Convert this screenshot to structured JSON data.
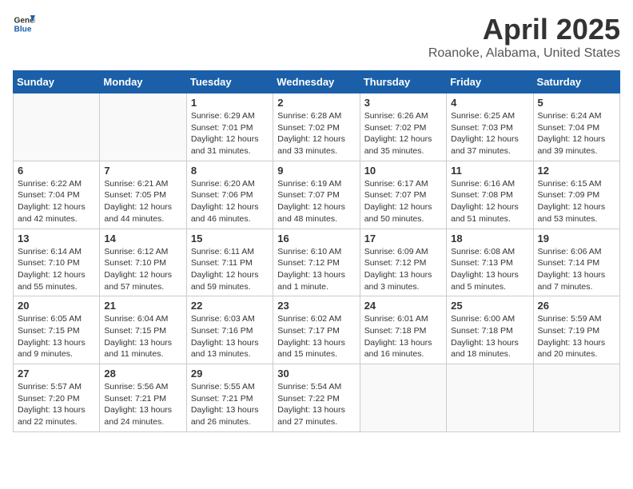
{
  "header": {
    "logo_general": "General",
    "logo_blue": "Blue",
    "title": "April 2025",
    "subtitle": "Roanoke, Alabama, United States"
  },
  "weekdays": [
    "Sunday",
    "Monday",
    "Tuesday",
    "Wednesday",
    "Thursday",
    "Friday",
    "Saturday"
  ],
  "weeks": [
    [
      {
        "day": "",
        "info": ""
      },
      {
        "day": "",
        "info": ""
      },
      {
        "day": "1",
        "info": "Sunrise: 6:29 AM\nSunset: 7:01 PM\nDaylight: 12 hours\nand 31 minutes."
      },
      {
        "day": "2",
        "info": "Sunrise: 6:28 AM\nSunset: 7:02 PM\nDaylight: 12 hours\nand 33 minutes."
      },
      {
        "day": "3",
        "info": "Sunrise: 6:26 AM\nSunset: 7:02 PM\nDaylight: 12 hours\nand 35 minutes."
      },
      {
        "day": "4",
        "info": "Sunrise: 6:25 AM\nSunset: 7:03 PM\nDaylight: 12 hours\nand 37 minutes."
      },
      {
        "day": "5",
        "info": "Sunrise: 6:24 AM\nSunset: 7:04 PM\nDaylight: 12 hours\nand 39 minutes."
      }
    ],
    [
      {
        "day": "6",
        "info": "Sunrise: 6:22 AM\nSunset: 7:04 PM\nDaylight: 12 hours\nand 42 minutes."
      },
      {
        "day": "7",
        "info": "Sunrise: 6:21 AM\nSunset: 7:05 PM\nDaylight: 12 hours\nand 44 minutes."
      },
      {
        "day": "8",
        "info": "Sunrise: 6:20 AM\nSunset: 7:06 PM\nDaylight: 12 hours\nand 46 minutes."
      },
      {
        "day": "9",
        "info": "Sunrise: 6:19 AM\nSunset: 7:07 PM\nDaylight: 12 hours\nand 48 minutes."
      },
      {
        "day": "10",
        "info": "Sunrise: 6:17 AM\nSunset: 7:07 PM\nDaylight: 12 hours\nand 50 minutes."
      },
      {
        "day": "11",
        "info": "Sunrise: 6:16 AM\nSunset: 7:08 PM\nDaylight: 12 hours\nand 51 minutes."
      },
      {
        "day": "12",
        "info": "Sunrise: 6:15 AM\nSunset: 7:09 PM\nDaylight: 12 hours\nand 53 minutes."
      }
    ],
    [
      {
        "day": "13",
        "info": "Sunrise: 6:14 AM\nSunset: 7:10 PM\nDaylight: 12 hours\nand 55 minutes."
      },
      {
        "day": "14",
        "info": "Sunrise: 6:12 AM\nSunset: 7:10 PM\nDaylight: 12 hours\nand 57 minutes."
      },
      {
        "day": "15",
        "info": "Sunrise: 6:11 AM\nSunset: 7:11 PM\nDaylight: 12 hours\nand 59 minutes."
      },
      {
        "day": "16",
        "info": "Sunrise: 6:10 AM\nSunset: 7:12 PM\nDaylight: 13 hours\nand 1 minute."
      },
      {
        "day": "17",
        "info": "Sunrise: 6:09 AM\nSunset: 7:12 PM\nDaylight: 13 hours\nand 3 minutes."
      },
      {
        "day": "18",
        "info": "Sunrise: 6:08 AM\nSunset: 7:13 PM\nDaylight: 13 hours\nand 5 minutes."
      },
      {
        "day": "19",
        "info": "Sunrise: 6:06 AM\nSunset: 7:14 PM\nDaylight: 13 hours\nand 7 minutes."
      }
    ],
    [
      {
        "day": "20",
        "info": "Sunrise: 6:05 AM\nSunset: 7:15 PM\nDaylight: 13 hours\nand 9 minutes."
      },
      {
        "day": "21",
        "info": "Sunrise: 6:04 AM\nSunset: 7:15 PM\nDaylight: 13 hours\nand 11 minutes."
      },
      {
        "day": "22",
        "info": "Sunrise: 6:03 AM\nSunset: 7:16 PM\nDaylight: 13 hours\nand 13 minutes."
      },
      {
        "day": "23",
        "info": "Sunrise: 6:02 AM\nSunset: 7:17 PM\nDaylight: 13 hours\nand 15 minutes."
      },
      {
        "day": "24",
        "info": "Sunrise: 6:01 AM\nSunset: 7:18 PM\nDaylight: 13 hours\nand 16 minutes."
      },
      {
        "day": "25",
        "info": "Sunrise: 6:00 AM\nSunset: 7:18 PM\nDaylight: 13 hours\nand 18 minutes."
      },
      {
        "day": "26",
        "info": "Sunrise: 5:59 AM\nSunset: 7:19 PM\nDaylight: 13 hours\nand 20 minutes."
      }
    ],
    [
      {
        "day": "27",
        "info": "Sunrise: 5:57 AM\nSunset: 7:20 PM\nDaylight: 13 hours\nand 22 minutes."
      },
      {
        "day": "28",
        "info": "Sunrise: 5:56 AM\nSunset: 7:21 PM\nDaylight: 13 hours\nand 24 minutes."
      },
      {
        "day": "29",
        "info": "Sunrise: 5:55 AM\nSunset: 7:21 PM\nDaylight: 13 hours\nand 26 minutes."
      },
      {
        "day": "30",
        "info": "Sunrise: 5:54 AM\nSunset: 7:22 PM\nDaylight: 13 hours\nand 27 minutes."
      },
      {
        "day": "",
        "info": ""
      },
      {
        "day": "",
        "info": ""
      },
      {
        "day": "",
        "info": ""
      }
    ]
  ]
}
